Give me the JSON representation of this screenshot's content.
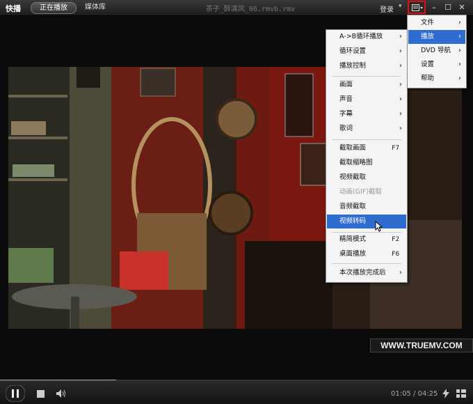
{
  "app": {
    "name": "快播",
    "file_title": "茶子_醉清风_06.rmvb.rmv"
  },
  "tabs": [
    {
      "label": "正在播放",
      "active": true
    },
    {
      "label": "媒体库",
      "active": false
    }
  ],
  "header": {
    "login": "登录",
    "login_arrow": "▾"
  },
  "window_controls": {
    "minimize": "–",
    "maximize": "☐",
    "close": "✕"
  },
  "main_menu": [
    {
      "label": "文件",
      "arrow": "›",
      "selected": false
    },
    {
      "label": "播放",
      "arrow": "›",
      "selected": true
    },
    {
      "label": "DVD 导航",
      "arrow": "›",
      "selected": false
    },
    {
      "label": "设置",
      "arrow": "›",
      "selected": false
    },
    {
      "label": "帮助",
      "arrow": "›",
      "selected": false
    }
  ],
  "play_submenu": {
    "group1": [
      {
        "label": "A->B循环播放",
        "arrow": "›"
      },
      {
        "label": "循环设置",
        "arrow": "›"
      },
      {
        "label": "播放控制",
        "arrow": "›"
      }
    ],
    "group2": [
      {
        "label": "画面",
        "arrow": "›"
      },
      {
        "label": "声音",
        "arrow": "›"
      },
      {
        "label": "字幕",
        "arrow": "›"
      },
      {
        "label": "歌词",
        "arrow": "›"
      }
    ],
    "group3": [
      {
        "label": "截取画面",
        "shortcut": "F7"
      },
      {
        "label": "截取缩略图",
        "shortcut": ""
      },
      {
        "label": "视频截取",
        "shortcut": ""
      },
      {
        "label": "动画(GIF)截取",
        "shortcut": "",
        "disabled": true
      },
      {
        "label": "音频截取",
        "shortcut": ""
      },
      {
        "label": "视频转码",
        "shortcut": "",
        "selected": true
      }
    ],
    "group4": [
      {
        "label": "精简模式",
        "shortcut": "F2"
      },
      {
        "label": "桌面播放",
        "shortcut": "F6"
      }
    ],
    "group5": [
      {
        "label": "本次播放完成后",
        "arrow": "›"
      }
    ]
  },
  "watermark": "WWW.TRUEMV.COM",
  "playback": {
    "current": "01:05",
    "separator": "/",
    "total": "04:25",
    "progress_fraction": 0.245
  },
  "colors": {
    "menu_highlight": "#2f6ccf",
    "menu_button_border": "#e01010"
  }
}
